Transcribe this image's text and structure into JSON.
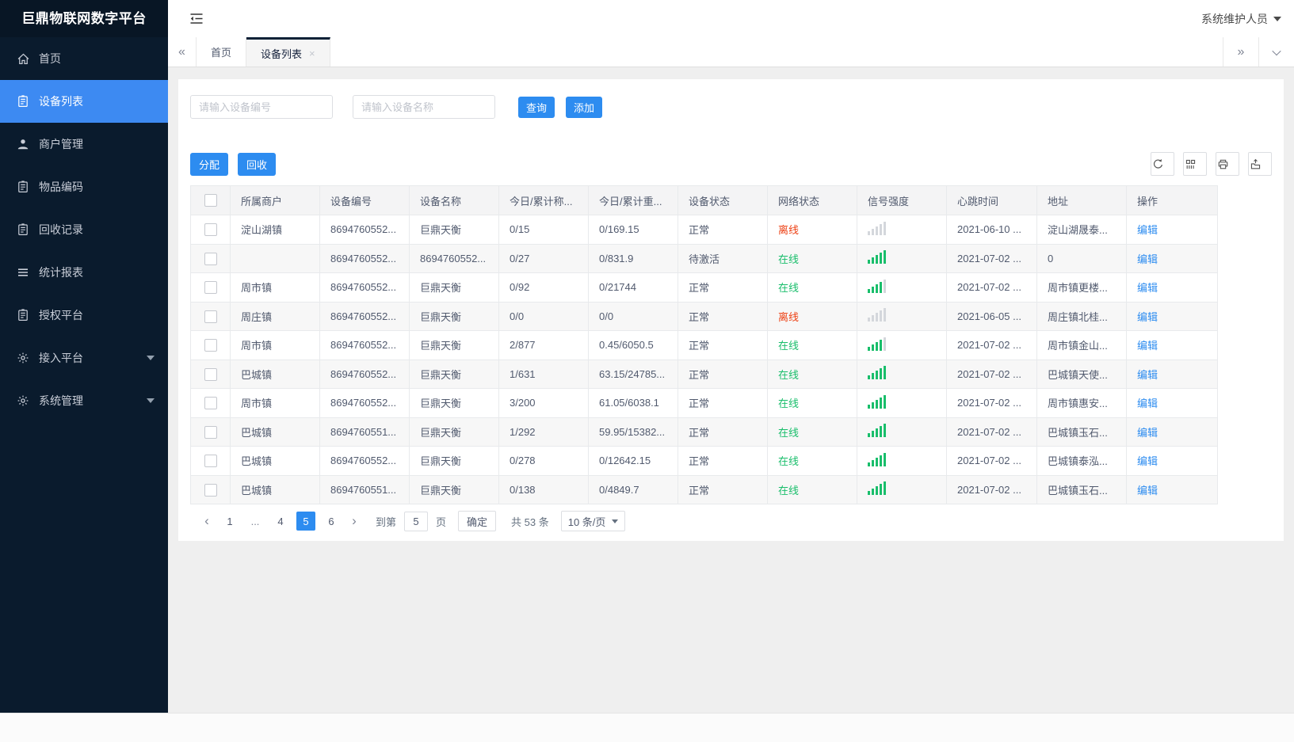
{
  "colors": {
    "primary": "#2d8cf0",
    "sidebar_bg": "#0a1b2d",
    "sidebar_active": "#3d8af2",
    "online": "#19be6b",
    "offline": "#ed4014"
  },
  "app": {
    "title": "巨鼎物联网数字平台",
    "user": "系统维护人员"
  },
  "sidebar": {
    "items": [
      {
        "id": "home",
        "icon": "home-icon",
        "label": "首页",
        "active": false,
        "expandable": false
      },
      {
        "id": "device-list",
        "icon": "list-icon",
        "label": "设备列表",
        "active": true,
        "expandable": false
      },
      {
        "id": "merchant-manage",
        "icon": "user-icon",
        "label": "商户管理",
        "active": false,
        "expandable": false
      },
      {
        "id": "item-code",
        "icon": "doc-icon",
        "label": "物品编码",
        "active": false,
        "expandable": false
      },
      {
        "id": "recycle-record",
        "icon": "doc-icon",
        "label": "回收记录",
        "active": false,
        "expandable": false
      },
      {
        "id": "stats-report",
        "icon": "stats-icon",
        "label": "统计报表",
        "active": false,
        "expandable": false
      },
      {
        "id": "auth-platform",
        "icon": "doc-icon",
        "label": "授权平台",
        "active": false,
        "expandable": false
      },
      {
        "id": "access-platform",
        "icon": "gear-icon",
        "label": "接入平台",
        "active": false,
        "expandable": true
      },
      {
        "id": "system-manage",
        "icon": "gear-icon",
        "label": "系统管理",
        "active": false,
        "expandable": true
      }
    ]
  },
  "tabs": {
    "items": [
      {
        "label": "首页",
        "active": false,
        "closable": false
      },
      {
        "label": "设备列表",
        "active": true,
        "closable": true
      }
    ]
  },
  "search": {
    "device_no_placeholder": "请输入设备编号",
    "device_name_placeholder": "请输入设备名称",
    "query_label": "查询",
    "add_label": "添加"
  },
  "toolbar": {
    "assign_label": "分配",
    "recycle_label": "回收",
    "icons": [
      "refresh-icon",
      "columns-icon",
      "print-icon",
      "export-icon"
    ]
  },
  "table": {
    "headers": [
      "所属商户",
      "设备编号",
      "设备名称",
      "今日/累计称...",
      "今日/累计重...",
      "设备状态",
      "网络状态",
      "信号强度",
      "心跳时间",
      "地址",
      "操作"
    ],
    "edit_label": "编辑",
    "rows": [
      {
        "merchant": "淀山湖镇",
        "device_no": "8694760552...",
        "device_name": "巨鼎天衡",
        "today_count": "0/15",
        "today_weight": "0/169.15",
        "device_status": "正常",
        "network_status": "离线",
        "online": false,
        "signal": 0,
        "heartbeat": "2021-06-10 ...",
        "address": "淀山湖晟泰..."
      },
      {
        "merchant": "",
        "device_no": "8694760552...",
        "device_name": "8694760552...",
        "today_count": "0/27",
        "today_weight": "0/831.9",
        "device_status": "待激活",
        "network_status": "在线",
        "online": true,
        "signal": 5,
        "heartbeat": "2021-07-02 ...",
        "address": "0"
      },
      {
        "merchant": "周市镇",
        "device_no": "8694760552...",
        "device_name": "巨鼎天衡",
        "today_count": "0/92",
        "today_weight": "0/21744",
        "device_status": "正常",
        "network_status": "在线",
        "online": true,
        "signal": 4,
        "heartbeat": "2021-07-02 ...",
        "address": "周市镇更楼..."
      },
      {
        "merchant": "周庄镇",
        "device_no": "8694760552...",
        "device_name": "巨鼎天衡",
        "today_count": "0/0",
        "today_weight": "0/0",
        "device_status": "正常",
        "network_status": "离线",
        "online": false,
        "signal": 0,
        "heartbeat": "2021-06-05 ...",
        "address": "周庄镇北桂..."
      },
      {
        "merchant": "周市镇",
        "device_no": "8694760552...",
        "device_name": "巨鼎天衡",
        "today_count": "2/877",
        "today_weight": "0.45/6050.5",
        "device_status": "正常",
        "network_status": "在线",
        "online": true,
        "signal": 4,
        "heartbeat": "2021-07-02 ...",
        "address": "周市镇金山..."
      },
      {
        "merchant": "巴城镇",
        "device_no": "8694760552...",
        "device_name": "巨鼎天衡",
        "today_count": "1/631",
        "today_weight": "63.15/24785...",
        "device_status": "正常",
        "network_status": "在线",
        "online": true,
        "signal": 5,
        "heartbeat": "2021-07-02 ...",
        "address": "巴城镇天使..."
      },
      {
        "merchant": "周市镇",
        "device_no": "8694760552...",
        "device_name": "巨鼎天衡",
        "today_count": "3/200",
        "today_weight": "61.05/6038.1",
        "device_status": "正常",
        "network_status": "在线",
        "online": true,
        "signal": 5,
        "heartbeat": "2021-07-02 ...",
        "address": "周市镇惠安..."
      },
      {
        "merchant": "巴城镇",
        "device_no": "8694760551...",
        "device_name": "巨鼎天衡",
        "today_count": "1/292",
        "today_weight": "59.95/15382...",
        "device_status": "正常",
        "network_status": "在线",
        "online": true,
        "signal": 5,
        "heartbeat": "2021-07-02 ...",
        "address": "巴城镇玉石..."
      },
      {
        "merchant": "巴城镇",
        "device_no": "8694760552...",
        "device_name": "巨鼎天衡",
        "today_count": "0/278",
        "today_weight": "0/12642.15",
        "device_status": "正常",
        "network_status": "在线",
        "online": true,
        "signal": 5,
        "heartbeat": "2021-07-02 ...",
        "address": "巴城镇泰泓..."
      },
      {
        "merchant": "巴城镇",
        "device_no": "8694760551...",
        "device_name": "巨鼎天衡",
        "today_count": "0/138",
        "today_weight": "0/4849.7",
        "device_status": "正常",
        "network_status": "在线",
        "online": true,
        "signal": 5,
        "heartbeat": "2021-07-02 ...",
        "address": "巴城镇玉石..."
      }
    ]
  },
  "pagination": {
    "pages": [
      "1",
      "...",
      "4",
      "5",
      "6"
    ],
    "active_page": "5",
    "jump_prefix": "到第",
    "jump_value": "5",
    "jump_suffix": "页",
    "confirm_label": "确定",
    "total_text": "共 53 条",
    "page_size_text": "10 条/页"
  }
}
